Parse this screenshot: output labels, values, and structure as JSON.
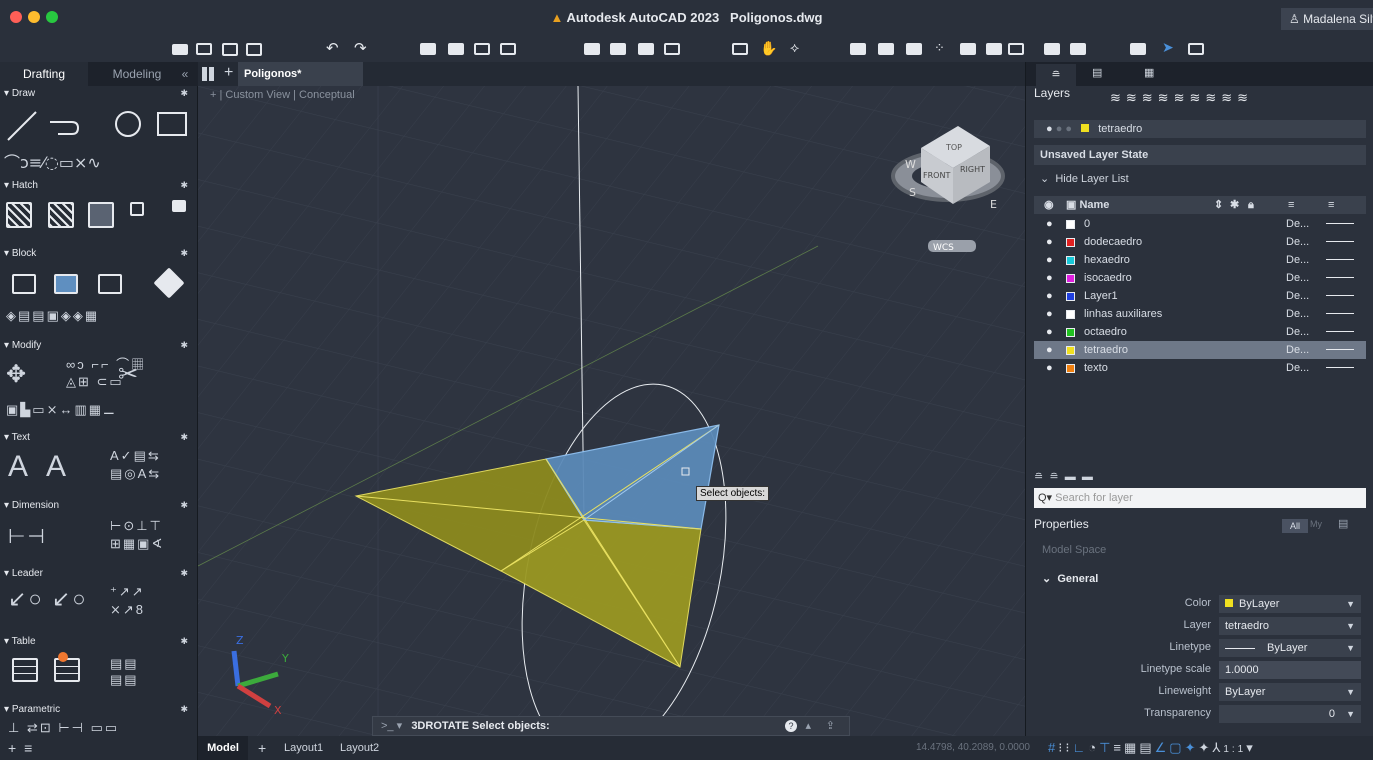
{
  "titlebar": {
    "app": "Autodesk AutoCAD 2023",
    "file": "Poligonos.dwg",
    "user": "Madalena Silv"
  },
  "left_panel": {
    "tabs": [
      "Drafting",
      "Modeling"
    ],
    "sections": [
      "Draw",
      "Hatch",
      "Block",
      "Modify",
      "Text",
      "Dimension",
      "Leader",
      "Table",
      "Parametric"
    ]
  },
  "doc_tab": {
    "name": "Poligonos*"
  },
  "viewport": {
    "labels": [
      "+",
      "Custom View",
      "Conceptual"
    ],
    "viewcube": {
      "top": "TOP",
      "front": "FRONT",
      "right": "RIGHT",
      "w": "W",
      "s": "S",
      "e": "E",
      "wcs": "WCS"
    },
    "tooltip": "Select objects:"
  },
  "command": {
    "prompt_icon": ">_",
    "text": "3DROTATE Select objects:"
  },
  "status": {
    "tabs": [
      "Model",
      "Layout1",
      "Layout2"
    ],
    "coords": "14.4798, 40.2089, 0.0000",
    "scale": "1:1"
  },
  "layers_panel": {
    "title": "Layers",
    "current": "tetraedro",
    "state": "Unsaved Layer State",
    "toggle": "Hide Layer List",
    "column_name": "Name",
    "rows": [
      {
        "name": "0",
        "color": "#ffffff",
        "lt": "De..."
      },
      {
        "name": "dodecaedro",
        "color": "#e02020",
        "lt": "De..."
      },
      {
        "name": "hexaedro",
        "color": "#18c8d8",
        "lt": "De..."
      },
      {
        "name": "isocaedro",
        "color": "#e020e0",
        "lt": "De..."
      },
      {
        "name": "Layer1",
        "color": "#2040e0",
        "lt": "De..."
      },
      {
        "name": "linhas auxiliares",
        "color": "#ffffff",
        "lt": "De..."
      },
      {
        "name": "octaedro",
        "color": "#20c020",
        "lt": "De..."
      },
      {
        "name": "tetraedro",
        "color": "#f0e020",
        "lt": "De...",
        "selected": true
      },
      {
        "name": "texto",
        "color": "#f08010",
        "lt": "De..."
      }
    ],
    "search_placeholder": "Search for layer"
  },
  "properties": {
    "title": "Properties",
    "filter_all": "All",
    "filter_my": "My",
    "space": "Model Space",
    "group": "General",
    "fields": [
      {
        "label": "Color",
        "value": "ByLayer"
      },
      {
        "label": "Layer",
        "value": "tetraedro"
      },
      {
        "label": "Linetype",
        "value": "ByLayer"
      },
      {
        "label": "Linetype scale",
        "value": "1.0000"
      },
      {
        "label": "Lineweight",
        "value": "ByLayer"
      },
      {
        "label": "Transparency",
        "value": "0"
      }
    ]
  },
  "colors": {
    "accent": "#4a90d9",
    "selected_face": "#5b8ab8",
    "yellow_face": "#8c8a1e"
  }
}
